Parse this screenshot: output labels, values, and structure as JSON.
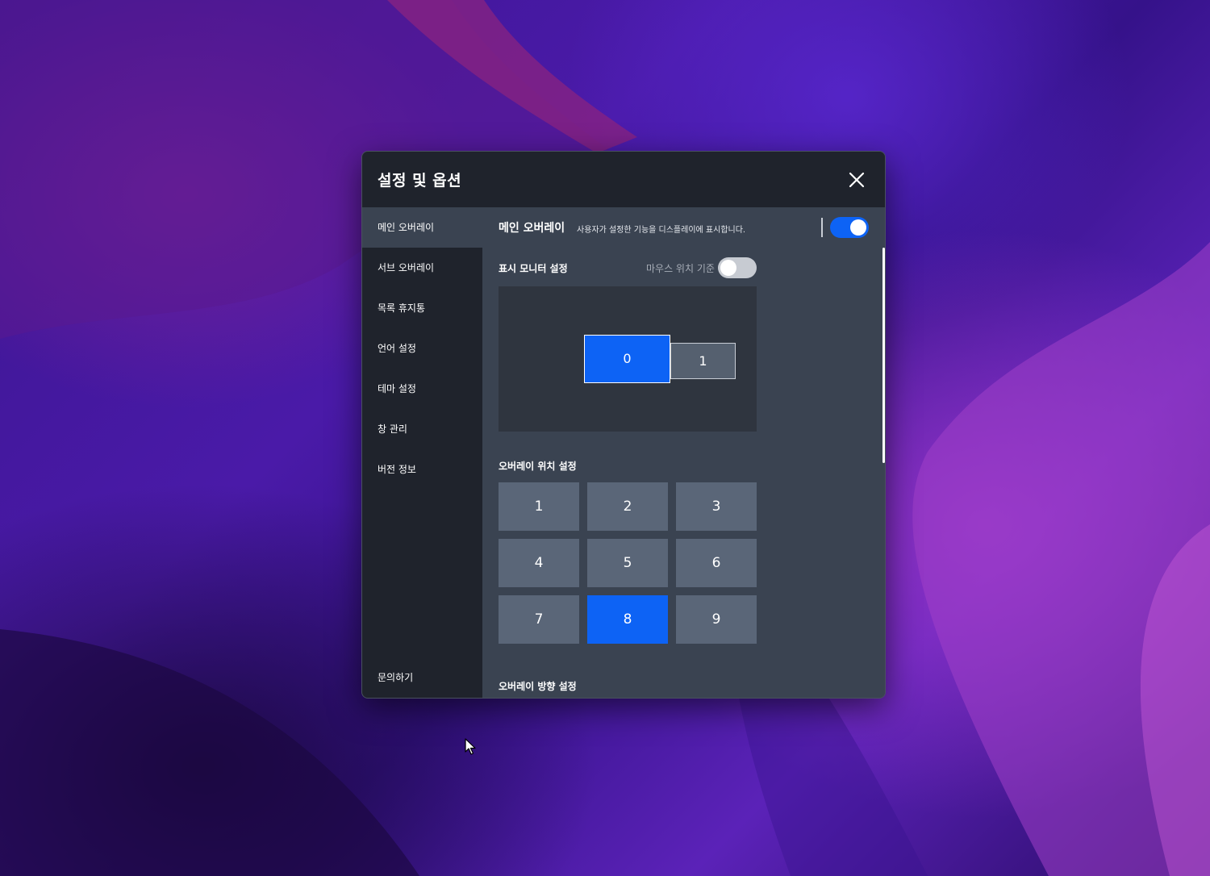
{
  "window": {
    "title": "설정 및 옵션"
  },
  "sidebar": {
    "items": [
      {
        "label": "메인 오버레이",
        "active": true
      },
      {
        "label": "서브 오버레이",
        "active": false
      },
      {
        "label": "목록 휴지통",
        "active": false
      },
      {
        "label": "언어 설정",
        "active": false
      },
      {
        "label": "테마 설정",
        "active": false
      },
      {
        "label": "창 관리",
        "active": false
      },
      {
        "label": "버전 정보",
        "active": false
      }
    ],
    "footer_label": "문의하기"
  },
  "main": {
    "section_title": "메인 오버레이",
    "section_description": "사용자가 설정한 기능을 디스플레이에 표시합니다.",
    "enabled": true,
    "monitor_settings": {
      "label": "표시 모니터 설정",
      "mouse_position_label": "마우스 위치 기준",
      "mouse_position_enabled": false,
      "monitors": [
        {
          "label": "0",
          "selected": true
        },
        {
          "label": "1",
          "selected": false
        }
      ]
    },
    "position_settings": {
      "label": "오버레이 위치 설정",
      "positions": [
        "1",
        "2",
        "3",
        "4",
        "5",
        "6",
        "7",
        "8",
        "9"
      ],
      "selected": "8"
    },
    "direction_settings": {
      "label": "오버레이 방향 설정"
    }
  },
  "colors": {
    "accent": "#0d63f5",
    "titlebar": "#1f232c",
    "content_bg": "#3a4351",
    "tile": "#5a6678"
  }
}
